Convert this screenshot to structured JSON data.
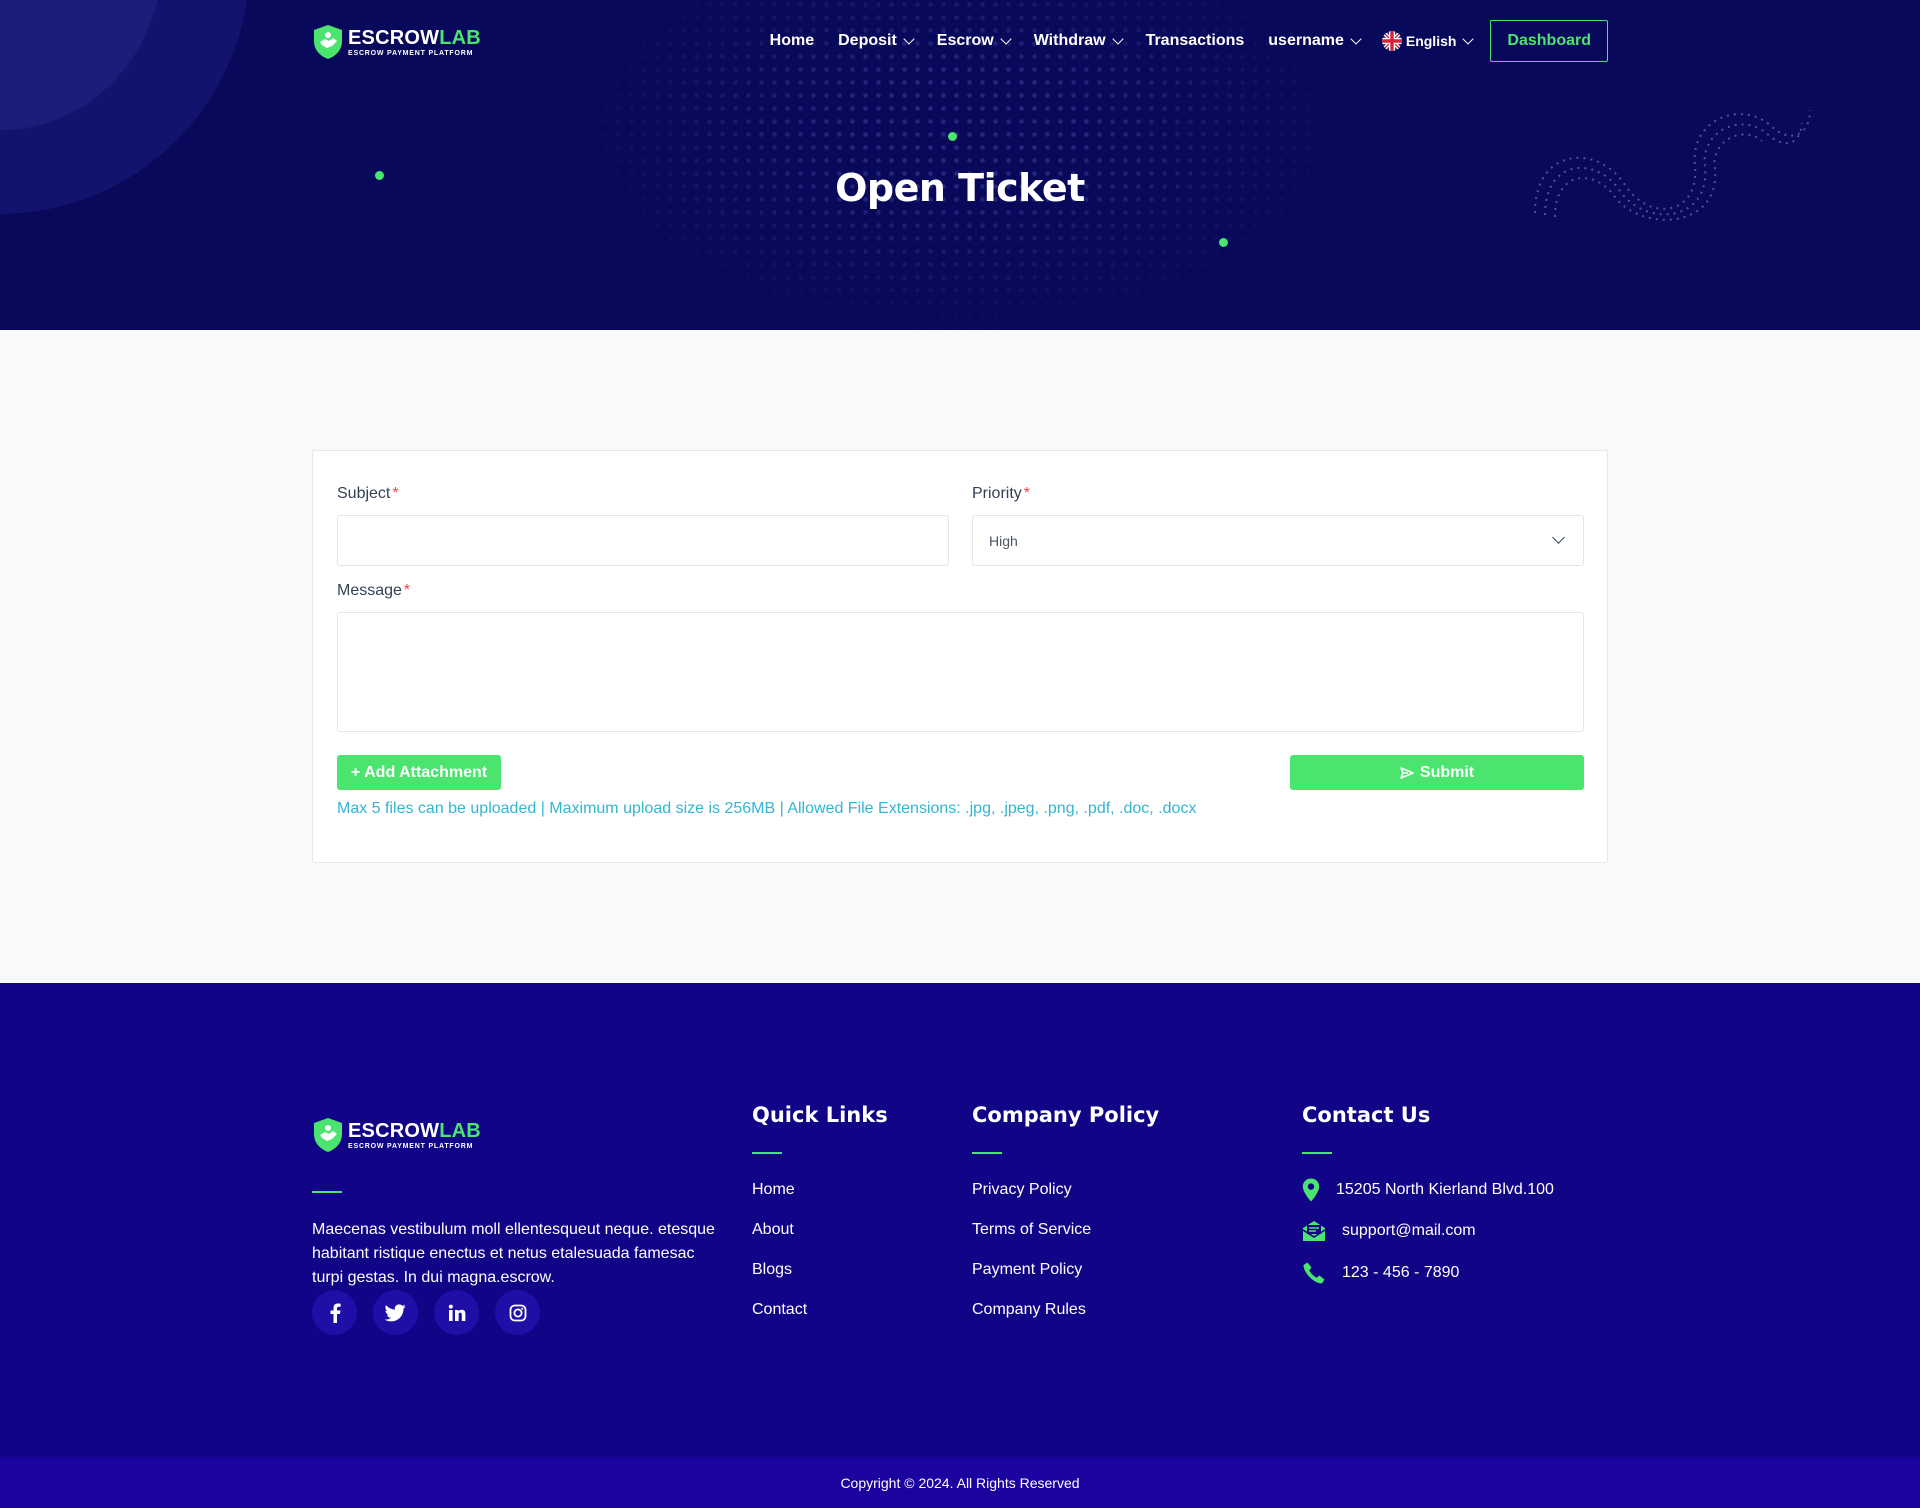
{
  "brand": {
    "name_main": "ESCROW",
    "name_accent": "LAB",
    "tagline": "ESCROW PAYMENT PLATFORM"
  },
  "nav": {
    "items": [
      {
        "label": "Home",
        "dropdown": false
      },
      {
        "label": "Deposit",
        "dropdown": true
      },
      {
        "label": "Escrow",
        "dropdown": true
      },
      {
        "label": "Withdraw",
        "dropdown": true
      },
      {
        "label": "Transactions",
        "dropdown": false
      },
      {
        "label": "username",
        "dropdown": true
      }
    ],
    "language": "English",
    "dashboard_label": "Dashboard"
  },
  "hero": {
    "title": "Open Ticket"
  },
  "form": {
    "subject_label": "Subject",
    "priority_label": "Priority",
    "message_label": "Message",
    "required_mark": "*",
    "subject_value": "",
    "priority_value": "High",
    "message_value": "",
    "add_attachment_label": "+ Add Attachment",
    "submit_label": "Submit",
    "upload_note": "Max 5 files can be uploaded | Maximum upload size is 256MB | Allowed File Extensions: .jpg, .jpeg, .png, .pdf, .doc, .docx"
  },
  "footer": {
    "about_text": "Maecenas vestibulum moll ellentesqueut neque. etesque habitant ristique enectus et netus etalesuada famesac turpi gestas. In dui magna.escrow.",
    "socials": [
      "facebook-icon",
      "twitter-icon",
      "linkedin-icon",
      "instagram-icon"
    ],
    "quick_links_title": "Quick Links",
    "quick_links": [
      "Home",
      "About",
      "Blogs",
      "Contact"
    ],
    "policy_title": "Company Policy",
    "policy_links": [
      "Privacy Policy",
      "Terms of Service",
      "Payment Policy",
      "Company Rules"
    ],
    "contact_title": "Contact Us",
    "contact": {
      "address": "15205 North Kierland Blvd.100",
      "email": "support@mail.com",
      "phone": "123 - 456 - 7890"
    },
    "copyright": "Copyright © 2024. All Rights Reserved"
  },
  "colors": {
    "hero_bg": "#08095a",
    "footer_bg": "#110486",
    "copyright_bg": "#1a039e",
    "accent_green": "#4ae46f",
    "note_cyan": "#32b6d3",
    "required_red": "#ef4444"
  }
}
